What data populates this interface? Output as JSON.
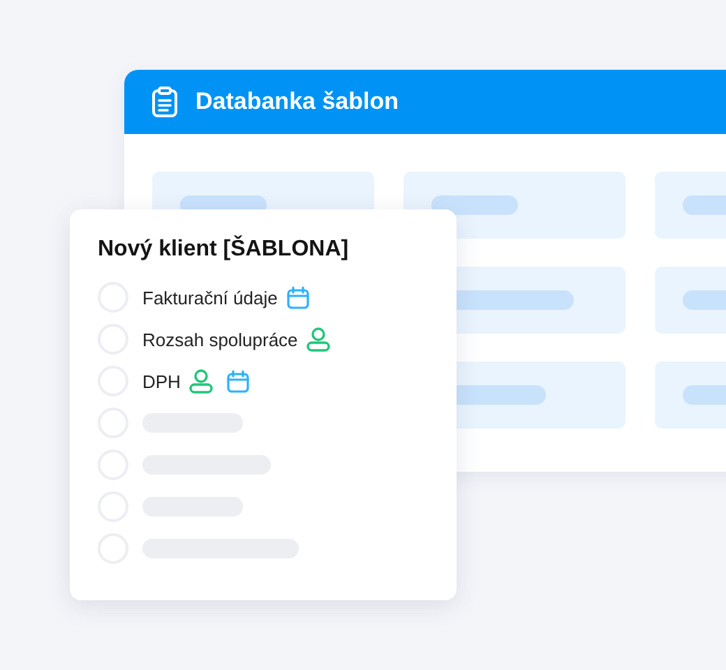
{
  "panel": {
    "title": "Databanka šablon"
  },
  "card": {
    "title": "Nový klient [ŠABLONA]",
    "items": [
      {
        "kind": "task",
        "label": "Fakturační údaje",
        "checked": false,
        "icons": [
          {
            "kind": "calendar"
          }
        ]
      },
      {
        "kind": "task",
        "label": "Rozsah spolupráce",
        "checked": false,
        "icons": [
          {
            "kind": "person"
          }
        ]
      },
      {
        "kind": "task",
        "label": "DPH",
        "checked": false,
        "icons": [
          {
            "kind": "person"
          },
          {
            "kind": "calendar"
          }
        ]
      },
      {
        "kind": "placeholder",
        "checked": false
      },
      {
        "kind": "placeholder",
        "checked": false
      },
      {
        "kind": "placeholder",
        "checked": false
      },
      {
        "kind": "placeholder",
        "checked": false
      }
    ]
  }
}
